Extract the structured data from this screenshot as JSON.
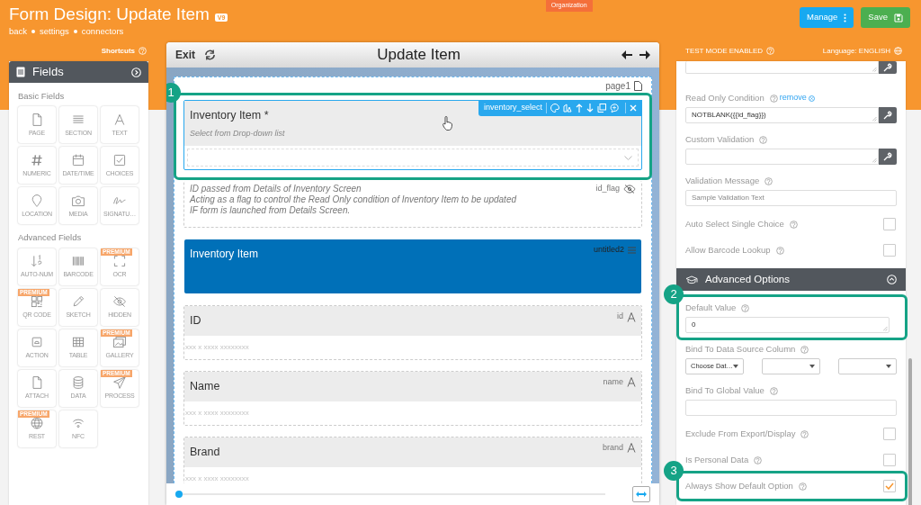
{
  "header": {
    "title": "Form Design: Update Item",
    "version": "V9",
    "breadcrumbs": [
      "back",
      "settings",
      "connectors"
    ],
    "org_tab": "Organization",
    "buttons": [
      {
        "kind": "manage",
        "label": "Manage"
      },
      {
        "kind": "save",
        "label": "Save"
      }
    ]
  },
  "shortcuts": {
    "label": "Shortcuts"
  },
  "fields_panel": {
    "title": "Fields",
    "groups": [
      {
        "title": "Basic Fields",
        "items": [
          {
            "label": "PAGE"
          },
          {
            "label": "SECTION"
          },
          {
            "label": "TEXT"
          },
          {
            "label": "NUMERIC"
          },
          {
            "label": "DATE/TIME"
          },
          {
            "label": "CHOICES"
          },
          {
            "label": "LOCATION"
          },
          {
            "label": "MEDIA"
          },
          {
            "label": "SIGNATU…"
          }
        ]
      },
      {
        "title": "Advanced Fields",
        "items": [
          {
            "label": "AUTO-NUM"
          },
          {
            "label": "BARCODE"
          },
          {
            "label": "OCR",
            "badge": "PREMIUM"
          },
          {
            "label": "QR CODE",
            "badge": "PREMIUM"
          },
          {
            "label": "SKETCH"
          },
          {
            "label": "HIDDEN"
          },
          {
            "label": "ACTION"
          },
          {
            "label": "TABLE"
          },
          {
            "label": "GALLERY",
            "badge": "PREMIUM"
          },
          {
            "label": "ATTACH"
          },
          {
            "label": "DATA"
          },
          {
            "label": "PROCESS",
            "badge": "PREMIUM"
          },
          {
            "label": "REST",
            "badge": "PREMIUM"
          },
          {
            "label": "NFC"
          }
        ]
      }
    ]
  },
  "editor": {
    "exit": "Exit",
    "title": "Update Item",
    "page": "page1",
    "fields": [
      {
        "kind": "dropdown",
        "label": "Inventory Item *",
        "hint": "Select from Drop-down list",
        "variable": "inventory_select",
        "selected": true,
        "callout": "1"
      },
      {
        "kind": "hidden",
        "note": "ID passed from Details of Inventory Screen\nActing as a flag to control the Read Only condition of Inventory Item to be updated\nIF form is launched from Details Screen.",
        "variable": "id_flag",
        "selected": false
      },
      {
        "kind": "section",
        "label": "Inventory Item",
        "variable": "untitled2",
        "selected": false
      },
      {
        "kind": "text",
        "label": "ID",
        "variable": "id",
        "placeholder": "xxx x xxxx xxxxxxxx",
        "selected": false
      },
      {
        "kind": "text",
        "label": "Name",
        "variable": "name",
        "placeholder": "xxx x xxxx xxxxxxxx",
        "selected": false
      },
      {
        "kind": "text",
        "label": "Brand",
        "variable": "brand",
        "placeholder": "xxx x xxxx xxxxxxxx",
        "selected": false
      }
    ],
    "zoom": {
      "level": 0
    }
  },
  "settings": {
    "test_mode": "TEST MODE ENABLED",
    "language": "Language: ENGLISH",
    "rows": [
      {
        "kind": "tail"
      },
      {
        "kind": "expr",
        "label": "Read Only Condition",
        "action": "remove",
        "value": "NOTBLANK({{id_flag}})"
      },
      {
        "kind": "expr",
        "label": "Custom Validation"
      },
      {
        "kind": "input",
        "label": "Validation Message",
        "placeholder": "Sample Validation Text"
      },
      {
        "kind": "check",
        "label": "Auto Select Single Choice",
        "checked": false
      },
      {
        "kind": "check",
        "label": "Allow Barcode Lookup",
        "checked": false
      },
      {
        "kind": "header",
        "label": "Advanced Options"
      },
      {
        "kind": "area",
        "label": "Default Value",
        "value": "0",
        "callout": "2"
      },
      {
        "kind": "selects",
        "label": "Bind To Data Source Column",
        "selects": [
          {
            "value": "Choose Dat…"
          },
          {
            "empty": true
          },
          {
            "empty": true
          }
        ]
      },
      {
        "kind": "input",
        "label": "Bind To Global Value"
      },
      {
        "kind": "check",
        "label": "Exclude From Export/Display",
        "checked": false
      },
      {
        "kind": "check",
        "label": "Is Personal Data",
        "checked": false
      },
      {
        "kind": "check",
        "label": "Always Show Default Option",
        "checked": true,
        "callout": "3"
      }
    ]
  }
}
